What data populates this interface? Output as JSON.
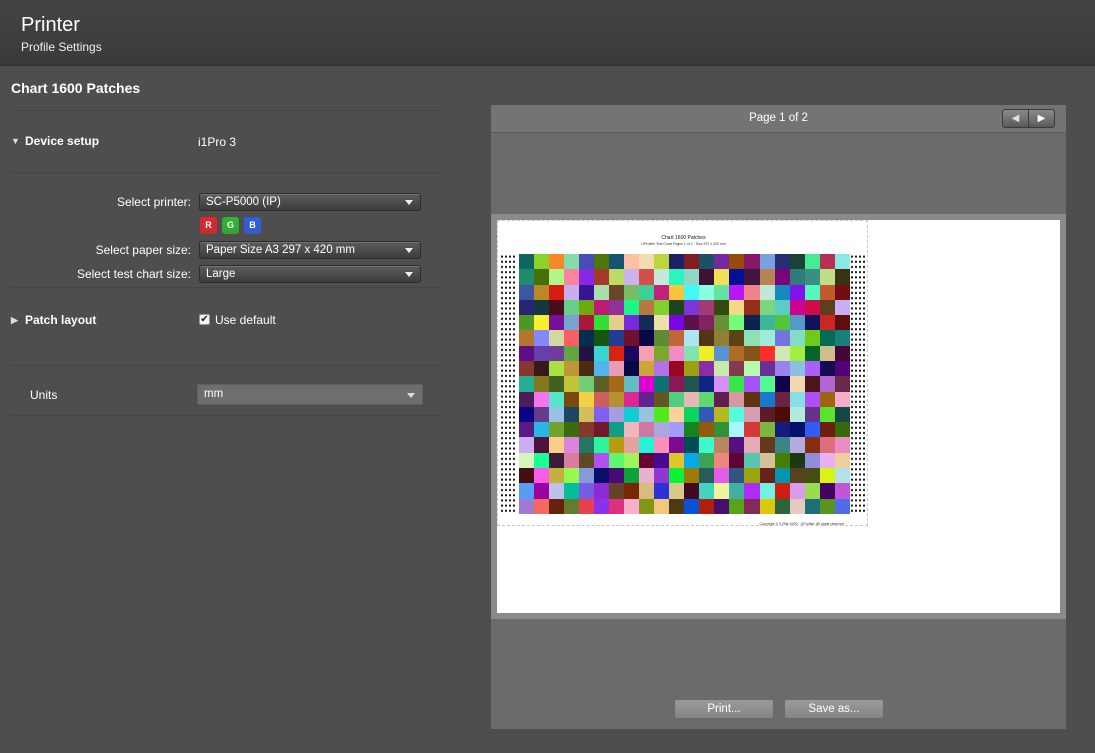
{
  "header": {
    "title": "Printer",
    "subtitle": "Profile Settings"
  },
  "chart_title": "Chart 1600 Patches",
  "device_setup": {
    "label": "Device setup",
    "value": "i1Pro 3"
  },
  "printer": {
    "label": "Select printer:",
    "value": "SC-P5000 (IP)",
    "channels": [
      "R",
      "G",
      "B"
    ],
    "channel_colors": [
      "#e0262a",
      "#2fb82f",
      "#2f5fe0"
    ]
  },
  "paper": {
    "label": "Select paper size:",
    "value": "Paper Size A3  297 x 420 mm"
  },
  "chart_size": {
    "label": "Select test chart size:",
    "value": "Large"
  },
  "patch_layout": {
    "label": "Patch layout",
    "checkbox_label": "Use default",
    "checked": true
  },
  "units": {
    "label": "Units",
    "value": "mm"
  },
  "preview": {
    "page_label": "Page 1 of 2",
    "sheet_title": "Chart 1600 Patches",
    "sheet_subtitle": "i1Profiler Test Chart Pages 1 of 2 · Size 297 x 420 mm",
    "sheet_footer": "Copyright © X-Rite 2020 · i1Profiler. All rights reserved.",
    "grid_columns": 22,
    "grid_rows": 17
  },
  "actions": {
    "print": "Print...",
    "save": "Save as..."
  }
}
